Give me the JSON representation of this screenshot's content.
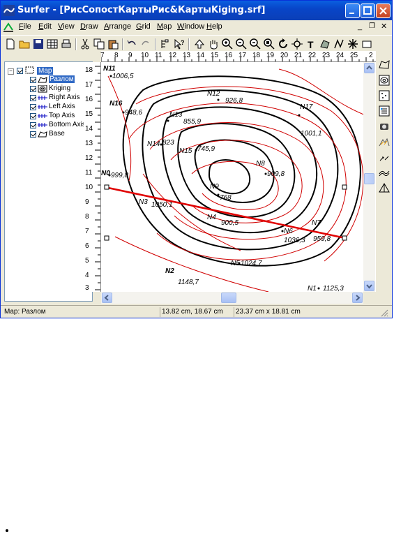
{
  "window": {
    "title": "Surfer - [РисСопостКартыРис&КартыKiging.srf]"
  },
  "menu": [
    {
      "label": "File",
      "key": "F"
    },
    {
      "label": "Edit",
      "key": "E"
    },
    {
      "label": "View",
      "key": "V"
    },
    {
      "label": "Draw",
      "key": "D"
    },
    {
      "label": "Arrange",
      "key": "A"
    },
    {
      "label": "Grid",
      "key": "G"
    },
    {
      "label": "Map",
      "key": "M"
    },
    {
      "label": "Window",
      "key": "W"
    },
    {
      "label": "Help",
      "key": "H"
    }
  ],
  "tree": {
    "root": "Map",
    "items": [
      "Разлом",
      "Kriging",
      "Right Axis",
      "Left Axis",
      "Top Axis",
      "Bottom Axis",
      "Base"
    ]
  },
  "ruler": {
    "h_ticks": [
      "7",
      "8",
      "9",
      "10",
      "11",
      "12",
      "13",
      "14",
      "15",
      "16",
      "17",
      "18",
      "19",
      "20",
      "21",
      "22",
      "23",
      "24",
      "25",
      "2"
    ],
    "v_ticks": [
      "18",
      "17",
      "16",
      "15",
      "14",
      "13",
      "12",
      "11",
      "10",
      "9",
      "8",
      "7",
      "6",
      "5",
      "4",
      "3"
    ]
  },
  "map_labels": {
    "n11": "N11",
    "v1006": "1006,5",
    "n16": "N16",
    "v948": "948,6",
    "n12": "N12",
    "v926": "926,8",
    "n13": "N13",
    "v855": "855,9",
    "n14": "N14",
    "v823": "823",
    "n15": "N15",
    "v745": "745,9",
    "n17": "N17",
    "v1001": "1001,1",
    "n8": "N8",
    "v909": "909,8",
    "n9": "N9",
    "v768": "768",
    "n0": "N0",
    "v999": "999,8",
    "n3": "N3",
    "v1050": "1050,1",
    "n4": "N4",
    "v900": "900,5",
    "n6": "N6",
    "v1036": "1036,3",
    "n7": "N7",
    "v959": "959,8",
    "n5": "N5",
    "v1024": "1024,7",
    "n2": "N2",
    "v1148": "1148,7",
    "n1": "N1",
    "v1125": "1125,3"
  },
  "status": {
    "left": "Map: Разлом",
    "coords": "13.82 cm, 18.67 cm",
    "size": "23.37 cm x 18.81 cm"
  },
  "colors": {
    "title_bg": "#0a5fe0",
    "contour_black": "#000000",
    "contour_red": "#d00000",
    "fault_line": "#e00000"
  }
}
